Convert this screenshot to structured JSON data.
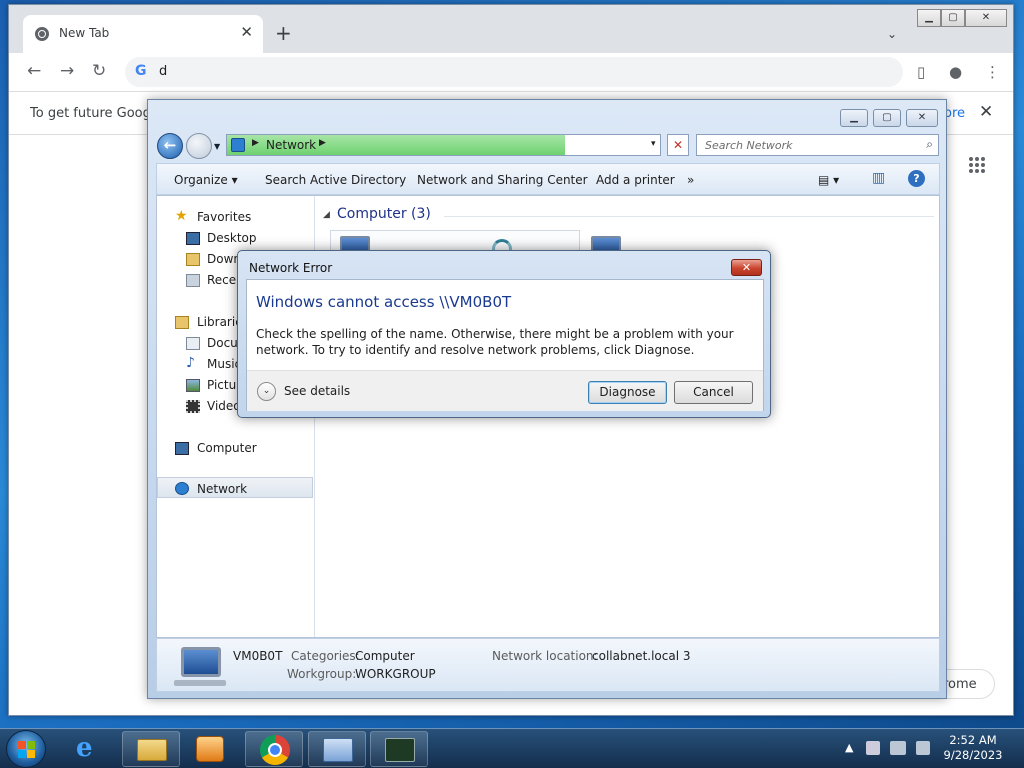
{
  "browser": {
    "tab_title": "New Tab",
    "tab_close": "✕",
    "new_tab": "+",
    "tab_menu": "⌄",
    "win_min": "▁",
    "win_max": "▢",
    "win_close": "✕",
    "back": "←",
    "forward": "→",
    "reload": "↻",
    "omnibox_icon": "G",
    "omnibox_value": "d",
    "sidepanel_icon": "▯",
    "profile_icon": "●",
    "menu_icon": "⋮",
    "info_message": "To get future Google",
    "info_link": "ore",
    "info_close": "✕",
    "customize_label": "rome"
  },
  "explorer": {
    "address": {
      "crumb": "Network",
      "dropdown": "▾",
      "stop": "✕"
    },
    "search_placeholder": "Search Network",
    "search_icon": "⌕",
    "toolbar": {
      "organize": "Organize ▾",
      "search_ad": "Search Active Directory",
      "network_center": "Network and Sharing Center",
      "add_printer": "Add a printer",
      "more": "»",
      "views": "▤ ▾",
      "preview": "▥",
      "help": "?"
    },
    "nav": {
      "favorites": "Favorites",
      "desktop": "Desktop",
      "downloads": "Down",
      "recent": "Recen",
      "libraries": "Librarie",
      "documents": "Docur",
      "music": "Music",
      "pictures": "Pictur",
      "videos": "Video",
      "computer": "Computer",
      "network": "Network"
    },
    "group_header": "Computer (3)",
    "group_toggle": "◢",
    "details": {
      "name": "VM0B0T",
      "categories_label": "Categories:",
      "categories_value": "Computer",
      "workgroup_label": "Workgroup:",
      "workgroup_value": "WORKGROUP",
      "location_label": "Network location:",
      "location_value": "collabnet.local  3"
    },
    "win_min": "▁",
    "win_max": "▢",
    "win_close": "✕"
  },
  "dialog": {
    "title": "Network Error",
    "close": "✕",
    "main_instruction": "Windows cannot access \\\\VM0B0T",
    "content": "Check the spelling of the name. Otherwise, there might be a problem with your network. To try to identify and resolve network problems, click Diagnose.",
    "see_details": "See details",
    "chevron": "⌄",
    "diagnose": "Diagnose",
    "cancel": "Cancel"
  },
  "taskbar": {
    "ie_glyph": "e",
    "tray_arrow": "▲",
    "time": "2:52 AM",
    "date": "9/28/2023"
  }
}
